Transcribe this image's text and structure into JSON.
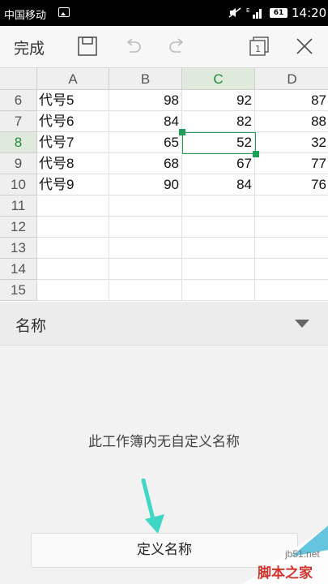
{
  "status_bar": {
    "carrier": "中国移动",
    "battery": "61",
    "time": "14:20"
  },
  "toolbar": {
    "done_label": "完成"
  },
  "sheet": {
    "columns": [
      "A",
      "B",
      "C",
      "D"
    ],
    "active_column": "C",
    "active_row": "8",
    "rows": [
      {
        "num": "6",
        "a": "代号5",
        "b": "98",
        "c": "92",
        "d": "87"
      },
      {
        "num": "7",
        "a": "代号6",
        "b": "84",
        "c": "82",
        "d": "88"
      },
      {
        "num": "8",
        "a": "代号7",
        "b": "65",
        "c": "52",
        "d": "32"
      },
      {
        "num": "9",
        "a": "代号8",
        "b": "68",
        "c": "67",
        "d": "77"
      },
      {
        "num": "10",
        "a": "代号9",
        "b": "90",
        "c": "84",
        "d": "76"
      },
      {
        "num": "11",
        "a": "",
        "b": "",
        "c": "",
        "d": ""
      },
      {
        "num": "12",
        "a": "",
        "b": "",
        "c": "",
        "d": ""
      },
      {
        "num": "13",
        "a": "",
        "b": "",
        "c": "",
        "d": ""
      },
      {
        "num": "14",
        "a": "",
        "b": "",
        "c": "",
        "d": ""
      },
      {
        "num": "15",
        "a": "",
        "b": "",
        "c": "",
        "d": ""
      }
    ]
  },
  "name_panel": {
    "title": "名称",
    "empty_message": "此工作簿内无自定义名称",
    "define_button": "定义名称"
  },
  "watermark": {
    "url": "jb51.net",
    "text": "脚本之家"
  },
  "colors": {
    "accent": "#1e9e57",
    "arrow": "#3fd6c6",
    "watermark_red": "#d0342c"
  }
}
